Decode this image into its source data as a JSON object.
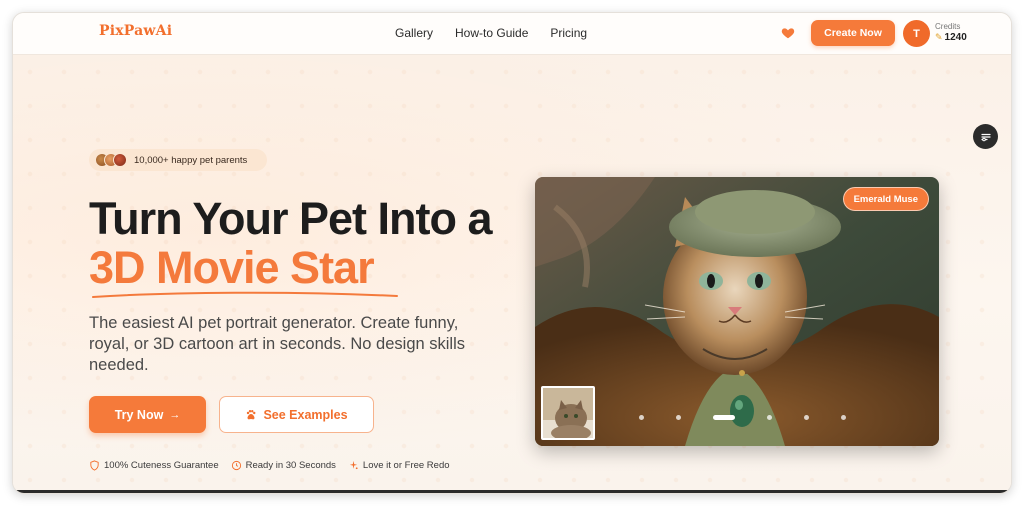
{
  "brand": {
    "logo_text": "PixPawAi",
    "accent": "#f57a3a"
  },
  "nav": {
    "links": [
      "Gallery",
      "How-to Guide",
      "Pricing"
    ],
    "favorites_icon": "heart-icon",
    "create_label": "Create Now",
    "avatar_initial": "T",
    "credits_label": "Credits",
    "credits_value": "1240",
    "credits_icon": "coin-icon"
  },
  "hero": {
    "badge_text": "10,000+ happy pet parents",
    "headline_line1": "Turn Your Pet Into a",
    "headline_line2": "3D Movie Star",
    "subtitle": "The easiest AI pet portrait generator. Create funny, royal, or 3D cartoon art in seconds. No design skills needed.",
    "primary_cta": "Try Now",
    "primary_cta_icon": "arrow-right-icon",
    "secondary_cta": "See Examples",
    "secondary_cta_icon": "paw-icon",
    "features": [
      {
        "icon": "shield-icon",
        "label": "100% Cuteness Guarantee"
      },
      {
        "icon": "clock-icon",
        "label": "Ready in 30 Seconds"
      },
      {
        "icon": "sparkle-icon",
        "label": "Love it or Free Redo"
      }
    ]
  },
  "showcase": {
    "style_label": "Emerald Muse",
    "carousel_dot_count": 6,
    "carousel_active_index": 2
  },
  "side_widget_icon": "settings-toggle-icon"
}
